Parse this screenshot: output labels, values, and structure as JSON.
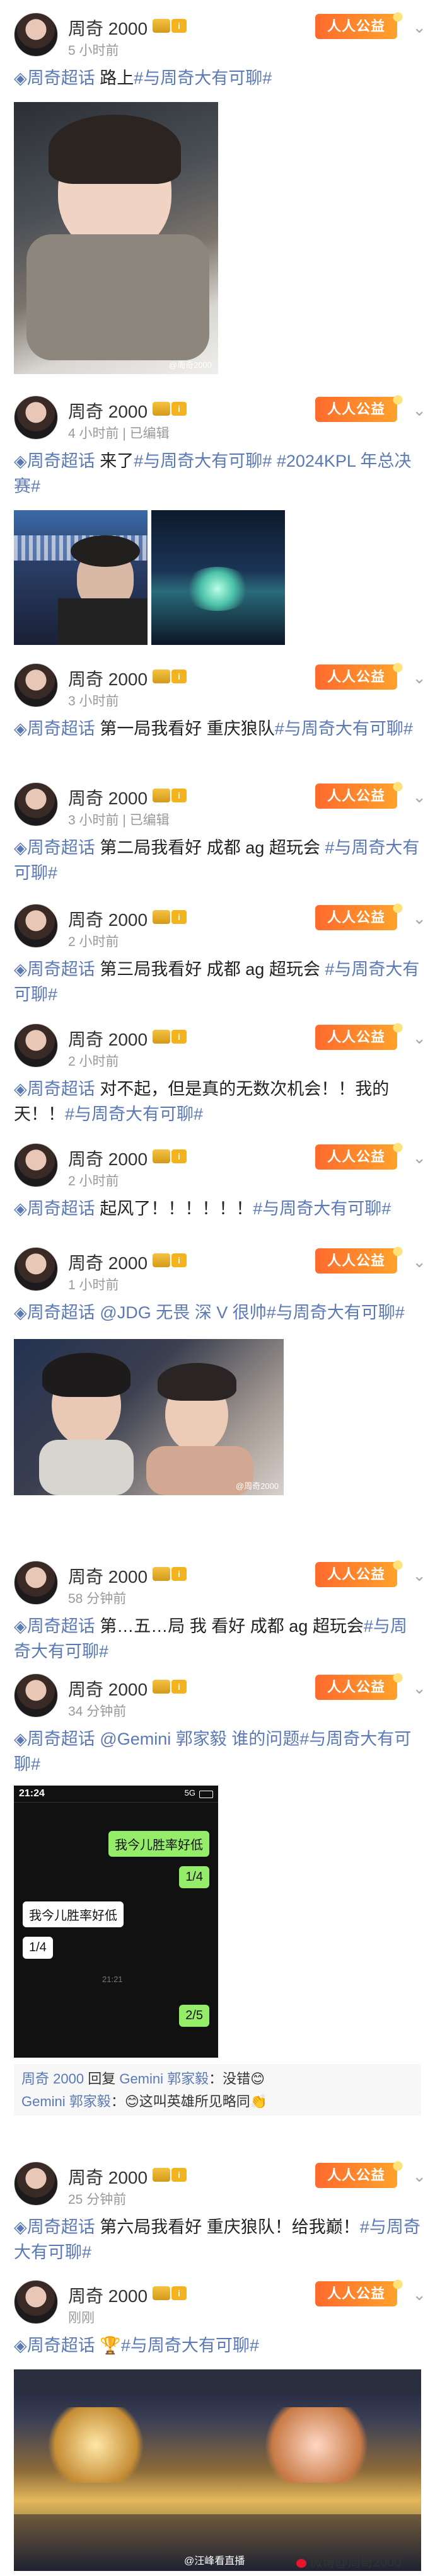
{
  "user": {
    "name": "周奇 2000",
    "vip_badge": "i"
  },
  "tag_badge": "人人公益",
  "topic": "周奇超话",
  "posts": [
    {
      "time": "5 小时前",
      "text": "路上",
      "hashtag": "#与周奇大有可聊#"
    },
    {
      "time": "4 小时前",
      "edited": "已编辑",
      "text": "来了",
      "hashtag": "#与周奇大有可聊# #2024KPL 年总决赛#"
    },
    {
      "time": "3 小时前",
      "text": "第一局我看好 重庆狼队",
      "hashtag": "#与周奇大有可聊#"
    },
    {
      "time": "3 小时前",
      "edited": "已编辑",
      "text": "第二局我看好 成都 ag 超玩会",
      "hashtag": "#与周奇大有可聊#"
    },
    {
      "time": "2 小时前",
      "text": "第三局我看好 成都 ag 超玩会",
      "hashtag": "#与周奇大有可聊#"
    },
    {
      "time": "2 小时前",
      "text": "对不起，但是真的无数次机会！！我的天！！",
      "hashtag": "#与周奇大有可聊#"
    },
    {
      "time": "2 小时前",
      "text": "起风了！！！！！！",
      "hashtag": "#与周奇大有可聊#"
    },
    {
      "time": "1 小时前",
      "text": "@JDG 无畏 深 V 很帅",
      "hashtag": "#与周奇大有可聊#"
    },
    {
      "time": "58 分钟前",
      "text": "第…五…局 我 看好 成都 ag 超玩会",
      "hashtag": "#与周奇大有可聊#"
    },
    {
      "time": "34 分钟前",
      "text": "@Gemini 郭家毅 谁的问题",
      "hashtag": "#与周奇大有可聊#"
    },
    {
      "time": "25 分钟前",
      "text": "第六局我看好 重庆狼队！给我巅！",
      "hashtag": "#与周奇大有可聊#"
    },
    {
      "time": "刚刚",
      "text": "🏆",
      "hashtag": "#与周奇大有可聊#"
    }
  ],
  "photo_watermark": "@周奇2000",
  "chat": {
    "status_time": "21:24",
    "status_net": "5G",
    "msg1": "我今儿胜率好低",
    "msg2": "1/4",
    "msg3": "我今儿胜率好低",
    "msg4": "1/4",
    "timestamp": "21:21",
    "msg5": "2/5"
  },
  "comments": [
    {
      "author": "周奇 2000",
      "action": "回复",
      "target": "Gemini 郭家毅",
      "text": "：没错😊"
    },
    {
      "author": "Gemini 郭家毅",
      "text": "：😊这叫英雄所见略同👏"
    }
  ],
  "footer": "微博@周奇2000",
  "footer_left": "@汪峰看直播"
}
